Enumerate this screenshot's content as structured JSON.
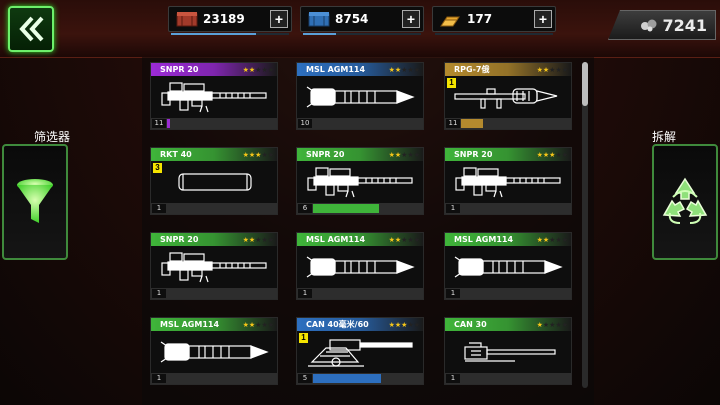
{
  "colors": {
    "purple": "#9b2bd6",
    "blue": "#2d6fbf",
    "gold": "#b48a2e",
    "green": "#3fb43a",
    "accent_green": "#6df06a"
  },
  "top": {
    "back_icon": "double-chevron-left-icon",
    "resources": [
      {
        "icon": "red-crate-icon",
        "value": "23189",
        "fill": 0.72
      },
      {
        "icon": "blue-crate-icon",
        "value": "8754",
        "fill": 0.28
      },
      {
        "icon": "gold-bars-icon",
        "value": "177",
        "fill": 0.0
      }
    ],
    "plus_label": "+",
    "score": {
      "icon": "ore-icon",
      "value": "7241"
    }
  },
  "left": {
    "label": "筛选器",
    "icon": "funnel-icon"
  },
  "right": {
    "label": "拆解",
    "icon": "recycle-icon"
  },
  "cards": [
    {
      "name": "SNPR 20",
      "tier": "purple",
      "stars": 2,
      "count": "11",
      "badge": "",
      "art": "sniper",
      "progress": 0.03
    },
    {
      "name": "MSL AGM114",
      "tier": "blue",
      "stars": 2,
      "count": "10",
      "badge": "",
      "art": "missile",
      "progress": 0
    },
    {
      "name": "RPG-7俄",
      "tier": "gold",
      "stars": 2,
      "count": "11",
      "badge": "1",
      "art": "rpg",
      "progress": 0.2
    },
    {
      "name": "RKT 40",
      "tier": "green",
      "stars": 3,
      "count": "1",
      "badge": "3",
      "art": "rocket",
      "progress": 0
    },
    {
      "name": "SNPR 20",
      "tier": "green",
      "stars": 2,
      "count": "6",
      "badge": "",
      "art": "sniper",
      "progress": 0.6
    },
    {
      "name": "SNPR 20",
      "tier": "green",
      "stars": 3,
      "count": "1",
      "badge": "",
      "art": "sniper",
      "progress": 0
    },
    {
      "name": "SNPR 20",
      "tier": "green",
      "stars": 2,
      "count": "1",
      "badge": "",
      "art": "sniper",
      "progress": 0
    },
    {
      "name": "MSL AGM114",
      "tier": "green",
      "stars": 2,
      "count": "1",
      "badge": "",
      "art": "missile",
      "progress": 0
    },
    {
      "name": "MSL AGM114",
      "tier": "green",
      "stars": 2,
      "count": "1",
      "badge": "",
      "art": "missile",
      "progress": 0
    },
    {
      "name": "MSL AGM114",
      "tier": "green",
      "stars": 2,
      "count": "1",
      "badge": "",
      "art": "missile",
      "progress": 0
    },
    {
      "name": "CAN 40毫米/60",
      "tier": "blue",
      "stars": 3,
      "count": "5",
      "badge": "1",
      "art": "cannon",
      "progress": 0.62
    },
    {
      "name": "CAN 30",
      "tier": "green",
      "stars": 1,
      "count": "1",
      "badge": "",
      "art": "autocannon",
      "progress": 0
    }
  ]
}
